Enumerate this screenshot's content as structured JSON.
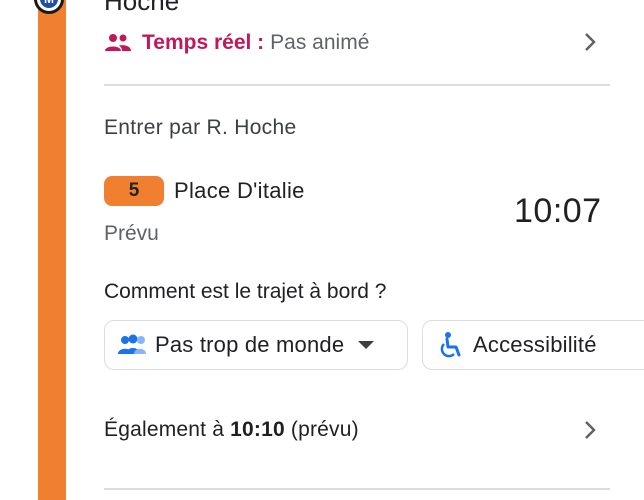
{
  "station": {
    "name": "Hoche",
    "badge_letter": "M"
  },
  "realtime": {
    "icon": "people-icon",
    "label": "Temps réel :",
    "value": "Pas animé"
  },
  "entrance": "Entrer par R. Hoche",
  "departure": {
    "line": "5",
    "destination": "Place D'italie",
    "status": "Prévu",
    "time": "10:07"
  },
  "feedback": {
    "question": "Comment est le trajet à bord ?",
    "crowd_label": "Pas trop de monde",
    "accessibility_label": "Accessibilité"
  },
  "also_at": {
    "prefix": "Également à ",
    "time": "10:10",
    "suffix": " (prévu)"
  },
  "colors": {
    "line_color": "#f08030",
    "realtime_color": "#c2185b",
    "icon_blue": "#1a73e8"
  }
}
